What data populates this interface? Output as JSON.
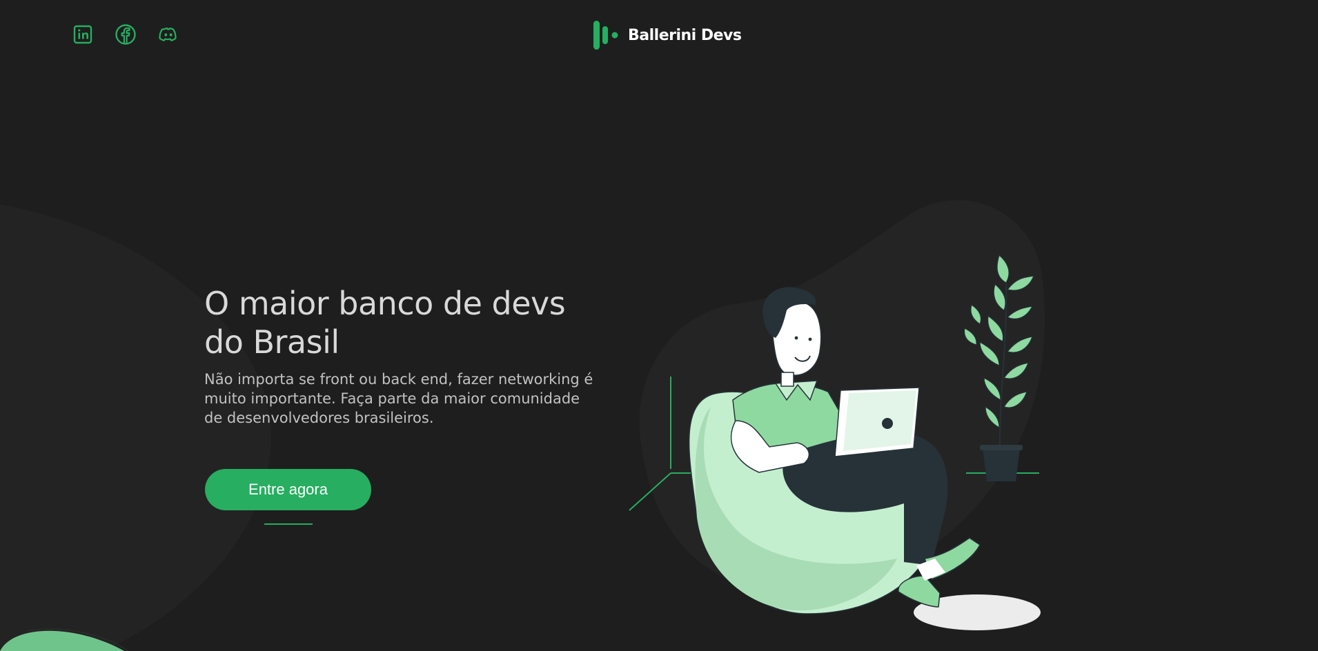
{
  "header": {
    "brand_name": "Ballerini Devs",
    "social": [
      "linkedin",
      "facebook",
      "discord"
    ]
  },
  "hero": {
    "title": "O maior banco de devs do Brasil",
    "text": "Não importa se front ou back end, fazer networking é muito importante. Faça parte da maior comunidade de desenvolvedores brasileiros.",
    "cta_label": "Entre agora"
  },
  "colors": {
    "background": "#1e1e1e",
    "accent": "#27ae60",
    "illustration_green": "#8ed9a0",
    "illustration_light": "#c4efcf",
    "illustration_dark": "#263238"
  },
  "icons": {
    "linkedin": "linkedin-icon",
    "facebook": "facebook-icon",
    "discord": "discord-icon",
    "logo": "ballerini-logo-icon"
  }
}
